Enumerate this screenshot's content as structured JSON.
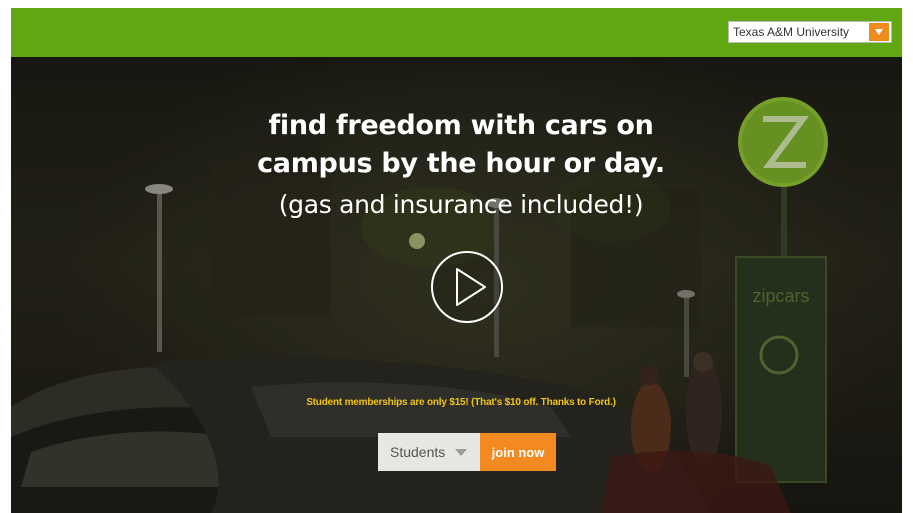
{
  "header": {
    "university_select": {
      "value": "Texas A&M University",
      "icon": "dropdown-arrow-icon",
      "arrow_color": "#ef8c1e"
    },
    "bar_color": "#5fa814"
  },
  "hero": {
    "headline_line1": "find freedom with cars on",
    "headline_line2": "campus by the hour or day.",
    "subline": "(gas and insurance included!)",
    "play_icon": "play-icon",
    "promo_text": "Student memberships are only $15! (That's $10 off. Thanks to Ford.)",
    "promo_color": "#f0c419",
    "sign_text": "zipcars"
  },
  "signup": {
    "membership_select_value": "Students",
    "join_button_label": "join now",
    "join_color": "#f28a21"
  }
}
